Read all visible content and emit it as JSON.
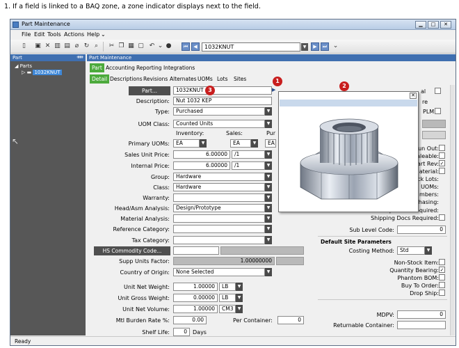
{
  "doc": {
    "instruction": "1. If a field is linked to a BAQ zone, a zone indicator displays next to the field."
  },
  "window": {
    "title": "Part Maintenance"
  },
  "menu": [
    "File",
    "Edit",
    "Tools",
    "Actions",
    "Help"
  ],
  "toolbar": {
    "key_value": "1032KNUT"
  },
  "tree": {
    "header": "Part",
    "root": "Parts",
    "item": "1032KNUT"
  },
  "main": {
    "header": "Part Maintenance",
    "tabs_top": [
      "Part",
      "Accounting",
      "Reporting",
      "Integrations"
    ],
    "tabs_sub": [
      "Detail",
      "Descriptions",
      "Revisions",
      "Alternates",
      "UOMs",
      "Lots",
      "Sites"
    ]
  },
  "form": {
    "part_button": "Part...",
    "part_value": "1032KNUT",
    "description_label": "Description:",
    "description_value": "Nut 1032 KEP",
    "type_label": "Type:",
    "type_value": "Purchased",
    "uomclass_label": "UOM Class:",
    "uomclass_value": "Counted Units",
    "inventory_hdr": "Inventory:",
    "sales_hdr": "Sales:",
    "pur_hdr": "Pur",
    "primary_uoms_label": "Primary UOMs:",
    "uom_inv": "EA",
    "uom_sales": "EA",
    "uom_pur": "EA",
    "sales_price_label": "Sales Unit Price:",
    "sales_price_value": "6.00000",
    "sales_price_per": "/1",
    "internal_price_label": "Internal Price:",
    "internal_price_value": "6.00000",
    "internal_price_per": "/1",
    "group_label": "Group:",
    "group_value": "Hardware",
    "class_label": "Class:",
    "class_value": "Hardware",
    "warranty_label": "Warranty:",
    "headasm_label": "Head/Asm Analysis:",
    "headasm_value": "Design/Prototype",
    "material_label": "Material Analysis:",
    "reference_label": "Reference Category:",
    "tax_label": "Tax Category:",
    "hs_button": "HS Commodity Code...",
    "supp_label": "Supp Units Factor:",
    "supp_value": "1.00000000",
    "country_label": "Country of Origin:",
    "country_value": "None Selected",
    "unit_net_weight_label": "Unit Net Weight:",
    "unit_net_weight_value": "1.00000",
    "unit_net_weight_uom": "LB",
    "unit_gross_weight_label": "Unit Gross Weight:",
    "unit_gross_weight_value": "0.00000",
    "unit_gross_weight_uom": "LB",
    "unit_net_volume_label": "Unit Net Volume:",
    "unit_net_volume_value": "1.00000",
    "unit_net_volume_uom": "CM3",
    "burden_label": "Mtl Burden Rate %:",
    "burden_value": "0.00",
    "per_container_label": "Per Container:",
    "per_container_value": "0",
    "shelf_label": "Shelf Life:",
    "shelf_value": "0",
    "shelf_unit": "Days"
  },
  "right": {
    "frag_al": "al",
    "frag_re": "re",
    "plm": "PLM:",
    "frag_tun_out": "tun Out:",
    "frag_saleable": "aleable:",
    "frag_art_rev": "art Rev:",
    "frag_material": "Material:",
    "frag_ck_lots": "ck Lots:",
    "frag_uoms": "UOMs:",
    "frag_mbers": "mbers:",
    "frag_chasing": "chasing:",
    "receipt_docs": "Receipt Docs Required:",
    "shipping_docs": "Shipping Docs Required:",
    "sub_level_label": "Sub Level Code:",
    "sub_level_value": "0",
    "site_params_hdr": "Default Site Parameters",
    "costing_label": "Costing Method:",
    "costing_value": "Std",
    "non_stock": "Non-Stock Item:",
    "qty_bearing": "Quantity Bearing:",
    "phantom": "Phantom BOM:",
    "buy_to_order": "Buy To Order:",
    "drop_ship": "Drop Ship:",
    "mdpv_label": "MDPV:",
    "mdpv_value": "0",
    "returnable_label": "Returnable Container:"
  },
  "badges": [
    "1",
    "2",
    "3"
  ],
  "status": {
    "text": "Ready"
  },
  "colors": {
    "tree_bg": "#575757",
    "header_blue": "#3f6fb0",
    "tab_green": "#4caa3c",
    "badge_red": "#c81e1e"
  }
}
